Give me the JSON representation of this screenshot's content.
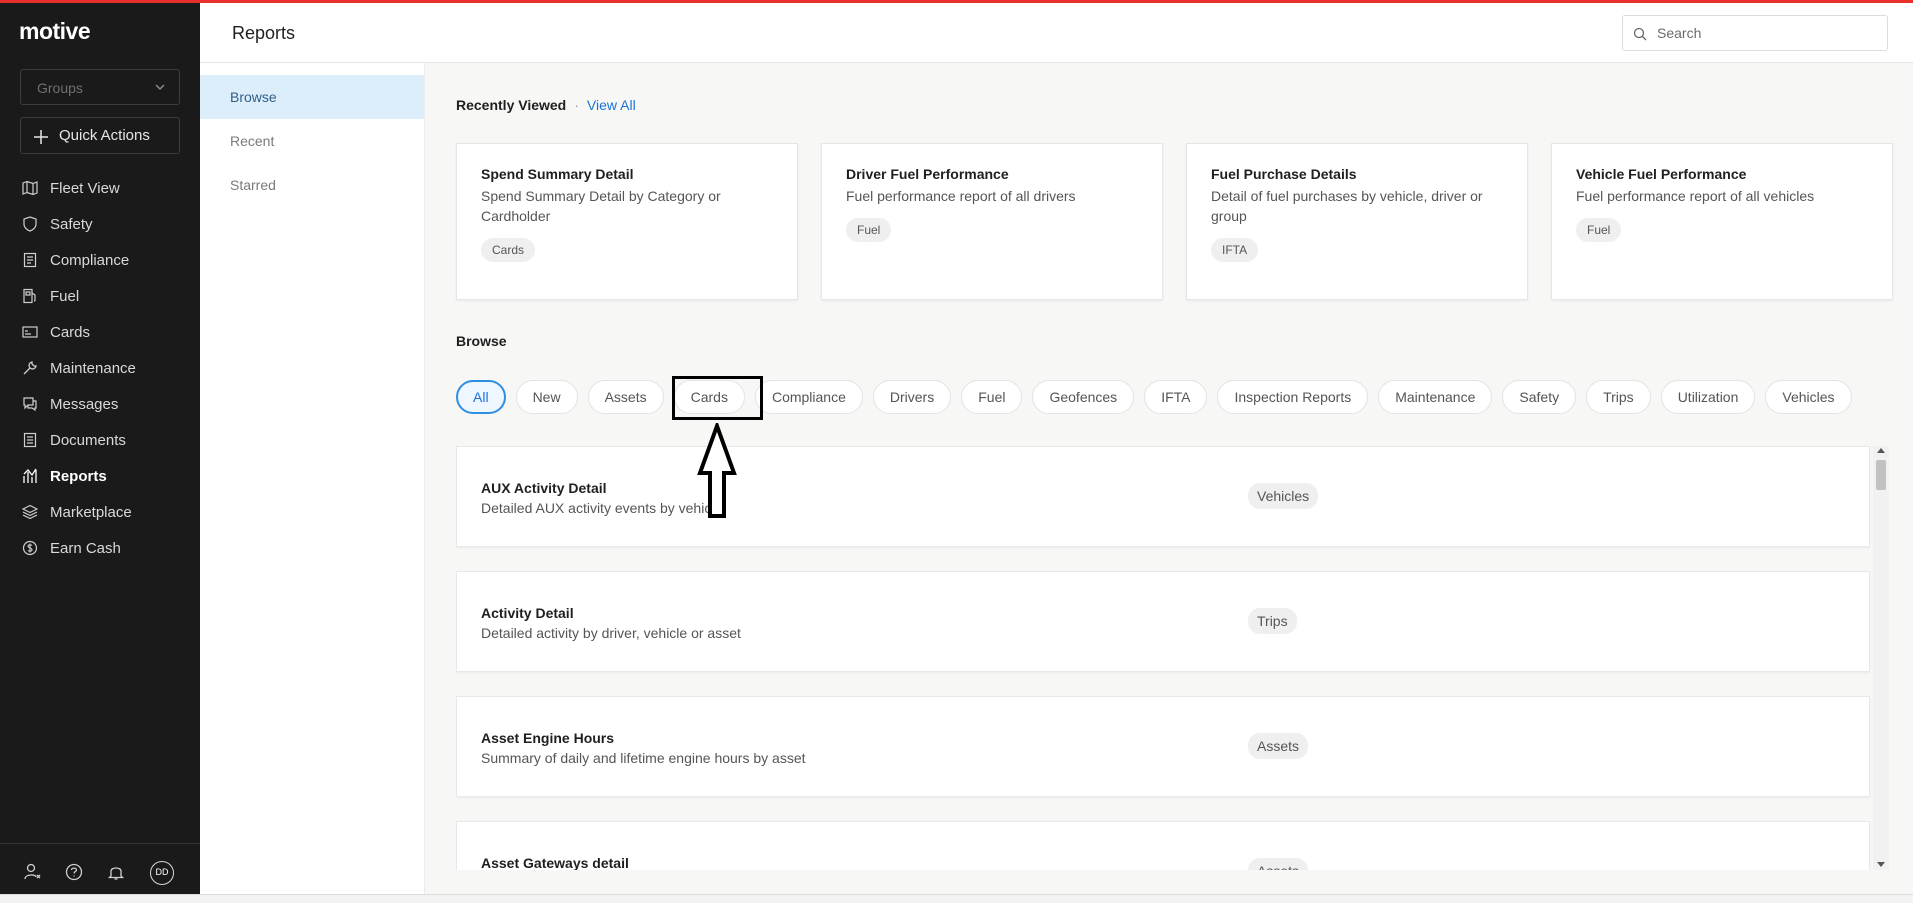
{
  "app": {
    "logo": "motive",
    "page_title": "Reports"
  },
  "sidebar": {
    "groups_placeholder": "Groups",
    "quick_actions": "Quick Actions",
    "items": [
      {
        "label": "Fleet View",
        "icon": "map-icon"
      },
      {
        "label": "Safety",
        "icon": "shield-icon"
      },
      {
        "label": "Compliance",
        "icon": "clipboard-icon"
      },
      {
        "label": "Fuel",
        "icon": "fuel-pump-icon"
      },
      {
        "label": "Cards",
        "icon": "credit-card-icon"
      },
      {
        "label": "Maintenance",
        "icon": "wrench-icon"
      },
      {
        "label": "Messages",
        "icon": "message-icon"
      },
      {
        "label": "Documents",
        "icon": "document-icon"
      },
      {
        "label": "Reports",
        "icon": "chart-icon",
        "active": true
      },
      {
        "label": "Marketplace",
        "icon": "layers-icon"
      },
      {
        "label": "Earn Cash",
        "icon": "dollar-icon"
      }
    ],
    "avatar_initials": "DD"
  },
  "search": {
    "placeholder": "Search"
  },
  "subnav": {
    "items": [
      {
        "label": "Browse",
        "active": true
      },
      {
        "label": "Recent"
      },
      {
        "label": "Starred"
      }
    ]
  },
  "recently_viewed": {
    "title": "Recently Viewed",
    "separator": "·",
    "view_all": "View All",
    "cards": [
      {
        "title": "Spend Summary Detail",
        "desc": "Spend Summary Detail by Category or Cardholder",
        "tag": "Cards"
      },
      {
        "title": "Driver Fuel Performance",
        "desc": "Fuel performance report of all drivers",
        "tag": "Fuel"
      },
      {
        "title": "Fuel Purchase Details",
        "desc": "Detail of fuel purchases by vehicle, driver or group",
        "tag": "IFTA"
      },
      {
        "title": "Vehicle Fuel Performance",
        "desc": "Fuel performance report of all vehicles",
        "tag": "Fuel"
      }
    ]
  },
  "browse": {
    "title": "Browse",
    "filters": [
      "All",
      "New",
      "Assets",
      "Cards",
      "Compliance",
      "Drivers",
      "Fuel",
      "Geofences",
      "IFTA",
      "Inspection Reports",
      "Maintenance",
      "Safety",
      "Trips",
      "Utilization",
      "Vehicles"
    ],
    "active_filter": "All",
    "reports": [
      {
        "title": "AUX Activity Detail",
        "desc": "Detailed AUX activity events by vehicle",
        "tag": "Vehicles"
      },
      {
        "title": "Activity Detail",
        "desc": "Detailed activity by driver, vehicle or asset",
        "tag": "Trips"
      },
      {
        "title": "Asset Engine Hours",
        "desc": "Summary of daily and lifetime engine hours by asset",
        "tag": "Assets"
      },
      {
        "title": "Asset Gateways detail",
        "desc": "",
        "tag": "Assets"
      }
    ]
  },
  "colors": {
    "sidebar_bg": "#1a1a1a",
    "accent": "#1a73d9",
    "top_bar": "#e8302a"
  }
}
